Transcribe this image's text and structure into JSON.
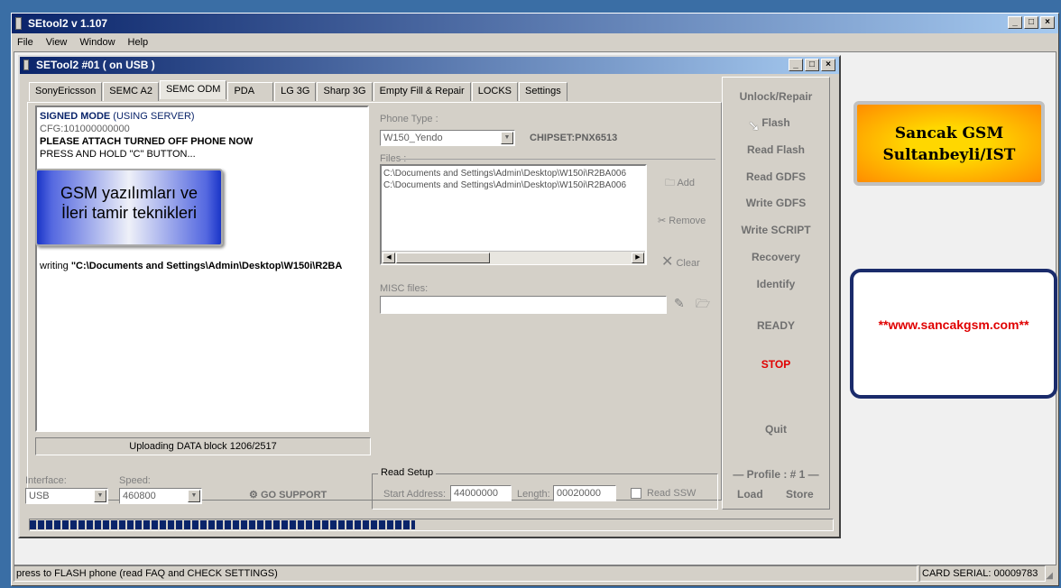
{
  "app": {
    "title": "SEtool2 v 1.107",
    "menu": [
      "File",
      "View",
      "Window",
      "Help"
    ]
  },
  "child": {
    "title": "SETool2 #01 ( on USB )",
    "tabs": [
      "SonyEricsson",
      "SEMC A2",
      "SEMC ODM",
      "PDA",
      "LG 3G",
      "Sharp 3G",
      "Empty Fill & Repair",
      "LOCKS",
      "Settings"
    ],
    "active_tab": "SEMC ODM"
  },
  "log": {
    "line1a": "SIGNED MODE",
    "line1b": "(USING SERVER)",
    "line2": "CFG:101000000000",
    "line3": "PLEASE ATTACH TURNED OFF PHONE NOW",
    "line4": "PRESS AND HOLD \"C\" BUTTON...",
    "writing_prefix": "writing ",
    "writing_path": "\"C:\\Documents and Settings\\Admin\\Desktop\\W150i\\R2BA"
  },
  "overlay": {
    "line1": "GSM yazılımları ve",
    "line2": "İleri tamir teknikleri"
  },
  "upload_status": "Uploading DATA block 1206/2517",
  "phone": {
    "type_label": "Phone Type :",
    "type_value": "W150_Yendo",
    "chipset": "CHIPSET:PNX6513",
    "files_label": "Files :",
    "files": [
      "C:\\Documents and Settings\\Admin\\Desktop\\W150i\\R2BA006",
      "C:\\Documents and Settings\\Admin\\Desktop\\W150i\\R2BA006"
    ],
    "add": "Add",
    "remove": "Remove",
    "clear": "Clear",
    "misc_label": "MISC files:"
  },
  "actions": {
    "unlock": "Unlock/Repair",
    "flash": "Flash",
    "read_flash": "Read Flash",
    "read_gdfs": "Read GDFS",
    "write_gdfs": "Write GDFS",
    "write_script": "Write SCRIPT",
    "recovery": "Recovery",
    "identify": "Identify",
    "ready": "READY",
    "stop": "STOP",
    "quit": "Quit",
    "profile": "Profile : # 1",
    "load": "Load",
    "store": "Store"
  },
  "bottom": {
    "interface_label": "Interface:",
    "interface_value": "USB",
    "speed_label": "Speed:",
    "speed_value": "460800",
    "go_support": "GO SUPPORT",
    "read_setup": "Read Setup",
    "start_label": "Start Address:",
    "start_value": "44000000",
    "length_label": "Length:",
    "length_value": "00020000",
    "read_ssw": "Read SSW",
    "progress": 0.48
  },
  "status": {
    "left": "press to FLASH phone  (read FAQ and CHECK SETTINGS)",
    "right": "CARD SERIAL: 00009783"
  },
  "ads": {
    "logo_line1": "Sancak GSM",
    "logo_line2": "Sultanbeyli/IST",
    "url": "**www.sancakgsm.com**"
  },
  "colors": {
    "title_blue": "#0a246a",
    "stop_red": "#e00000",
    "ad_red": "#e00000"
  }
}
